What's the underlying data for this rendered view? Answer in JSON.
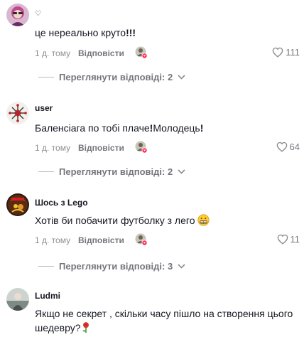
{
  "comments": [
    {
      "username": "♡",
      "text": "це нереально круто",
      "text_suffix": "!!!",
      "time": "1 д. тому",
      "reply_label": "Відповісти",
      "likes": "111",
      "view_replies": "Переглянути відповіді: 2"
    },
    {
      "username": "user",
      "text": "Баленсіага по тобі плаче",
      "text_mid": "!",
      "text_after": "Молодець",
      "text_suffix": "!",
      "time": "1 д. тому",
      "reply_label": "Відповісти",
      "likes": "64",
      "view_replies": "Переглянути відповіді: 2"
    },
    {
      "username": "Шось з Lego",
      "text": "Хотів би побачити футболку з лего",
      "time": "1 д. тому",
      "reply_label": "Відповісти",
      "likes": "11",
      "view_replies": "Переглянути відповіді: 3"
    },
    {
      "username": "Ludmi",
      "text": "Якщо не секрет , скільки часу пішло на створення цього шедевру?"
    }
  ],
  "icons": {
    "like": "heart-outline-icon",
    "view_replies": "chevron-down-icon",
    "creator_like": "creator-liked-avatar-icon"
  },
  "colors": {
    "text": "#161823",
    "secondary": "#8a8b91",
    "like_badge": "#fe2c55"
  }
}
